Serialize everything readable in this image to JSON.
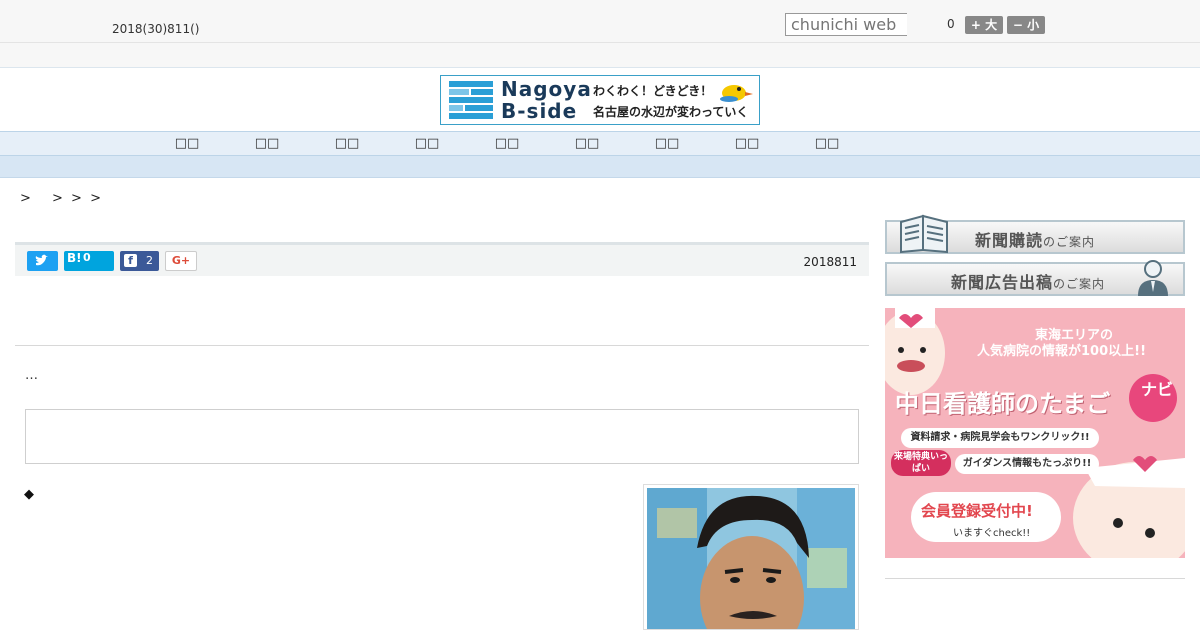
{
  "header": {
    "date": "2018(30)811()",
    "search_placeholder": "chunichi web",
    "count": "0",
    "font_larger": "+ 大",
    "font_smaller": "− 小"
  },
  "banner": {
    "title_line1": "Nagoya",
    "title_line2": "B-side",
    "tagline1": "わくわく！どきどき！",
    "tagline2": "名古屋の水辺が変わっていく"
  },
  "nav": {
    "items": [
      "□□",
      "□□",
      "□□",
      "□□",
      "□□",
      "□□",
      "□□",
      "□□",
      "□□"
    ]
  },
  "breadcrumb": "> 　> > >",
  "share": {
    "hatena_count": "0",
    "facebook_count": "2",
    "published_date": "2018811"
  },
  "article": {
    "ellipsis": "…",
    "bullet": "◆"
  },
  "sidebar": {
    "subscribe_main": "新聞購読",
    "subscribe_sub": "のご案内",
    "advert_main": "新聞広告出稿",
    "advert_sub": "のご案内"
  },
  "ad": {
    "line1": "東海エリアの",
    "line2": "人気病院の情報が100以上!!",
    "title": "中日看護師のたまご",
    "navi": "ナビ",
    "pill1": "資料請求・病院見学会もワンクリック!!",
    "badge": "来場特典いっぱい",
    "pill2": "ガイダンス情報もたっぷり!!",
    "cta": "会員登録受付中!",
    "cta_sub": "いますぐcheck!!"
  },
  "colors": {
    "nav_bg": "#e6eff8",
    "twitter": "#1da1f2",
    "hatena": "#00a4de",
    "facebook": "#3b5998",
    "ad_pink": "#f6b3bc"
  }
}
